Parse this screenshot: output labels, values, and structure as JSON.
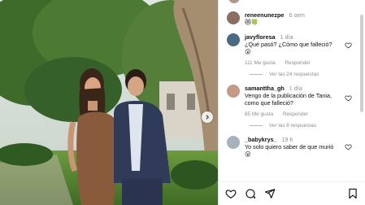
{
  "colors": {
    "text": "#111111",
    "muted": "#8e8e8e",
    "border": "#e3e3e3"
  },
  "post": {
    "photo_alt": "",
    "caption_user": "reneenunezpe",
    "caption_time": "6 sem",
    "caption_text": "😻🍀"
  },
  "comments": [
    {
      "user": "javyfloresa",
      "time": "1 día",
      "text": "¿Qué pasó? ¿Cómo que falleció?",
      "emoji": "😮",
      "likes": "111 Me gusta",
      "reply_label": "Responder",
      "view_replies": "Ver las 24 respuestas"
    },
    {
      "user": "samanttha_gh",
      "time": "1 día",
      "text": "Vengo de la publicación de Tania, como que falleció?",
      "likes": "85 Me gusta",
      "reply_label": "Responder",
      "view_replies": "Ver las 8 respuestas"
    },
    {
      "user": "_babykrys_",
      "time": "19 h",
      "text": "Yo solo quiero saber de que murió",
      "emoji": "😮"
    }
  ],
  "actions": {
    "icons": [
      "heart-icon",
      "comment-icon",
      "share-icon",
      "bookmark-icon"
    ]
  }
}
